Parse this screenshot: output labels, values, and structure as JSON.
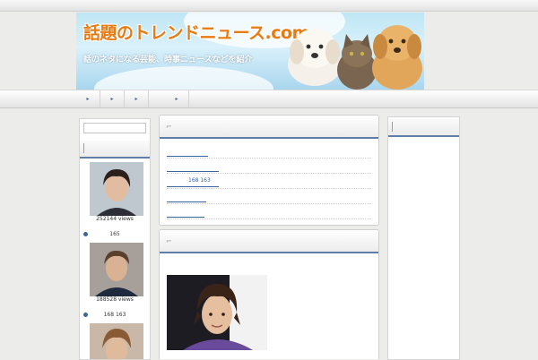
{
  "header": {
    "site_title": "話題のトレンドニュース.com",
    "tagline": "話のネタになる芸能、時事ニュースなどを紹介"
  },
  "nav": {
    "items": [
      {
        "label": "▸"
      },
      {
        "label": "▸"
      },
      {
        "label": "▸"
      },
      {
        "label": "▸"
      }
    ]
  },
  "sidebar_left": {
    "ranking": [
      {
        "views": "252144 views",
        "title": "165"
      },
      {
        "views": "188528 views",
        "title": "168 163"
      }
    ]
  },
  "main": {
    "news": [
      {
        "title": ""
      },
      {
        "title": ""
      },
      {
        "title": "168 163"
      },
      {
        "title": ""
      },
      {
        "title": ""
      }
    ]
  },
  "colors": {
    "accent": "#5f7ea8",
    "title_orange": "#e87a12",
    "link": "#3a66a0",
    "page_bg": "#ececea"
  }
}
